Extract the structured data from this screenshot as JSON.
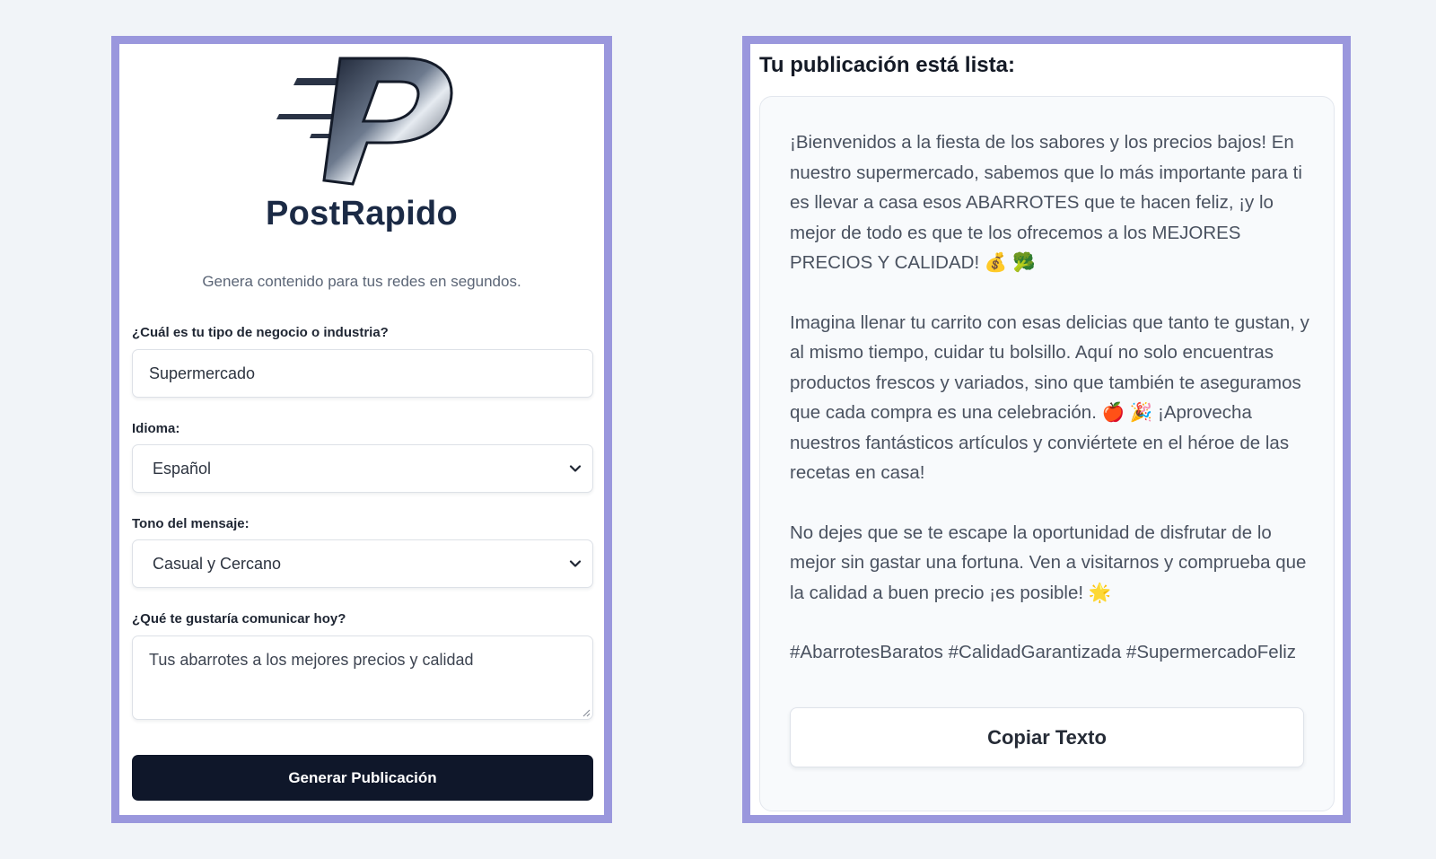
{
  "brand": {
    "name": "PostRapido",
    "tagline": "Genera contenido para tus redes en segundos."
  },
  "form": {
    "business": {
      "label": "¿Cuál es tu tipo de negocio o industria?",
      "value": "Supermercado"
    },
    "language": {
      "label": "Idioma:",
      "value": "Español"
    },
    "tone": {
      "label": "Tono del mensaje:",
      "value": "Casual y Cercano"
    },
    "message": {
      "label": "¿Qué te gustaría comunicar hoy?",
      "value": "Tus abarrotes a los mejores precios y calidad"
    },
    "submit_label": "Generar Publicación"
  },
  "result": {
    "title": "Tu publicación está lista:",
    "paragraphs": [
      "¡Bienvenidos a la fiesta de los sabores y los precios bajos! En nuestro supermercado, sabemos que lo más importante para ti es llevar a casa esos ABARROTES que te hacen feliz, ¡y lo mejor de todo es que te los ofrecemos a los MEJORES PRECIOS Y CALIDAD! 💰 🥦",
      "Imagina llenar tu carrito con esas delicias que tanto te gustan, y al mismo tiempo, cuidar tu bolsillo. Aquí no solo encuentras productos frescos y variados, sino que también te aseguramos que cada compra es una celebración. 🍎 🎉 ¡Aprovecha nuestros fantásticos artículos y conviértete en el héroe de las recetas en casa!",
      "No dejes que se te escape la oportunidad de disfrutar de lo mejor sin gastar una fortuna. Ven a visitarnos y comprueba que la calidad a buen precio ¡es posible! 🌟",
      "#AbarrotesBaratos #CalidadGarantizada #SupermercadoFeliz"
    ],
    "copy_label": "Copiar Texto"
  },
  "colors": {
    "page_bg": "#f1f4f8",
    "panel_border": "#9a97dd",
    "primary_button": "#0f172a",
    "brand_text": "#1b2a45"
  },
  "icons": {
    "logo": "postrapido-logo-icon",
    "select_arrow": "chevron-down-icon"
  }
}
